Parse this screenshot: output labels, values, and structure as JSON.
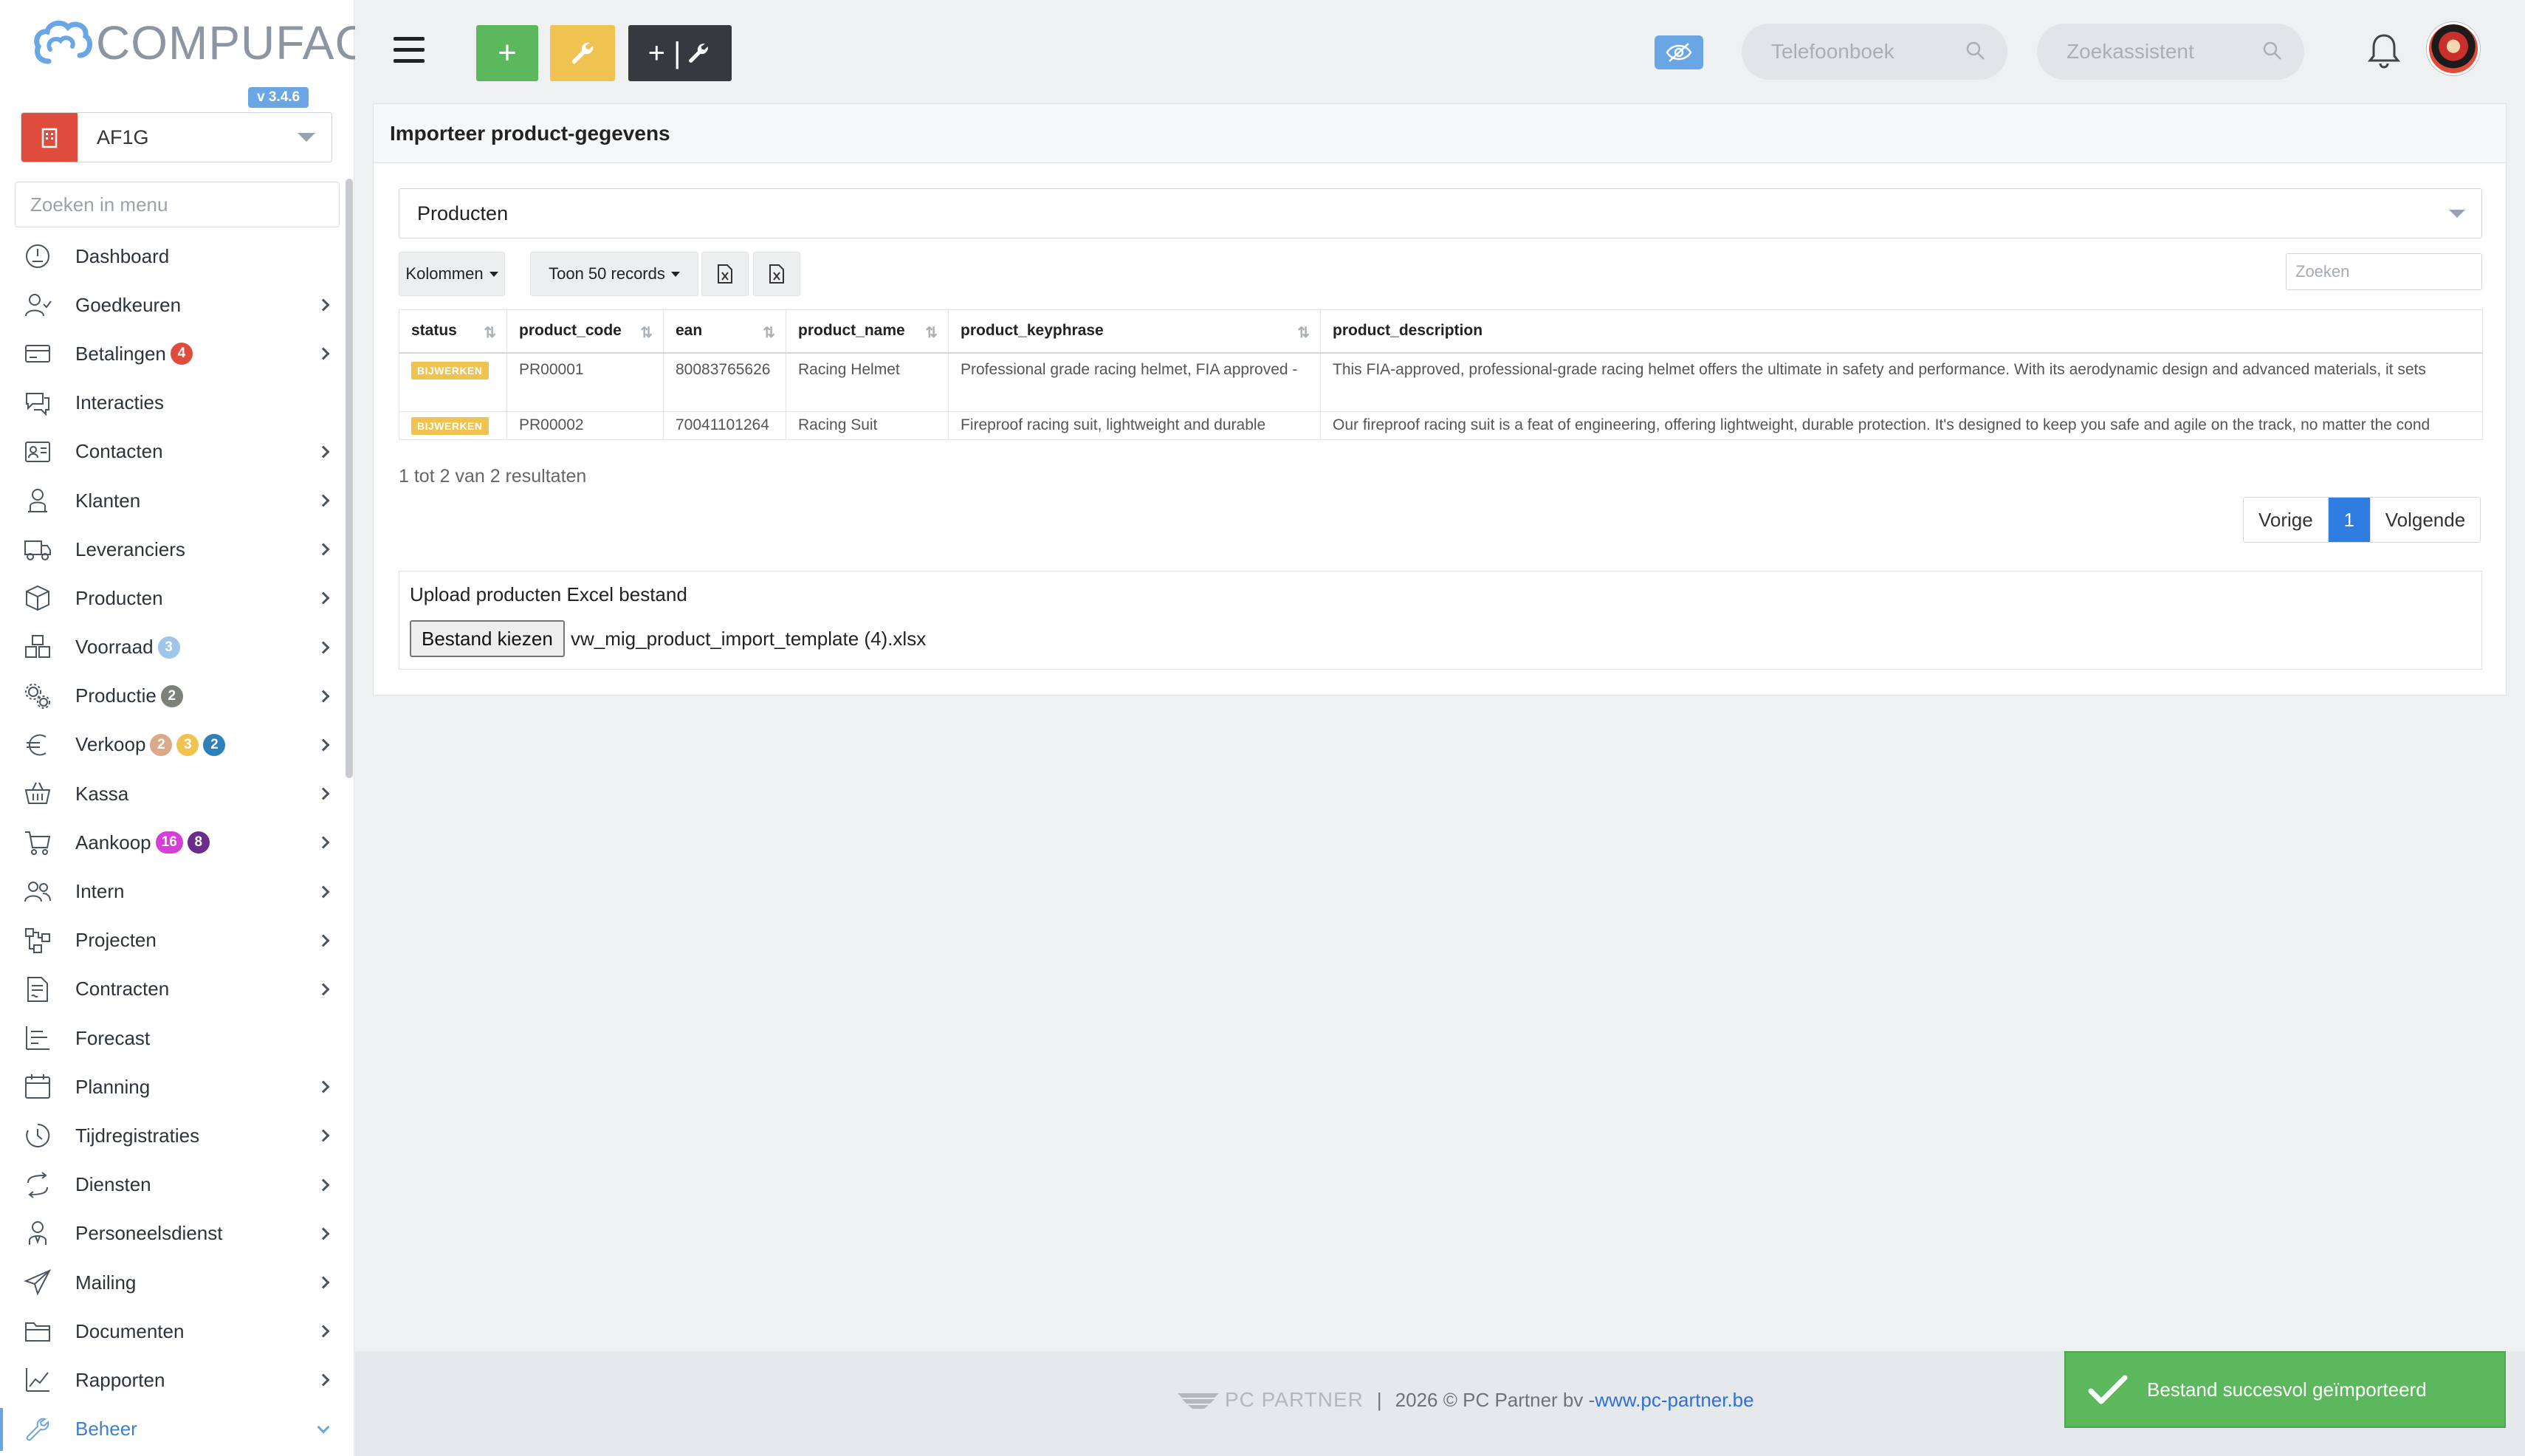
{
  "app": {
    "brand": "COMPUFACT",
    "version": "v 3.4.6",
    "company": "AF1G"
  },
  "sidebar": {
    "search_placeholder": "Zoeken in menu",
    "items": [
      {
        "label": "Dashboard",
        "icon": "dashboard-gauge-icon",
        "chevron": false,
        "badges": []
      },
      {
        "label": "Goedkeuren",
        "icon": "user-check-icon",
        "chevron": true,
        "badges": []
      },
      {
        "label": "Betalingen",
        "icon": "credit-card-icon",
        "chevron": true,
        "badges": [
          {
            "text": "4",
            "color": "#e04c3c"
          }
        ]
      },
      {
        "label": "Interacties",
        "icon": "chat-bubbles-icon",
        "chevron": false,
        "badges": []
      },
      {
        "label": "Contacten",
        "icon": "contact-card-icon",
        "chevron": true,
        "badges": []
      },
      {
        "label": "Klanten",
        "icon": "customer-icon",
        "chevron": true,
        "badges": []
      },
      {
        "label": "Leveranciers",
        "icon": "truck-icon",
        "chevron": true,
        "badges": []
      },
      {
        "label": "Producten",
        "icon": "box-icon",
        "chevron": true,
        "badges": []
      },
      {
        "label": "Voorraad",
        "icon": "boxes-icon",
        "chevron": true,
        "badges": [
          {
            "text": "3",
            "color": "#9ec5ea"
          }
        ]
      },
      {
        "label": "Productie",
        "icon": "gears-icon",
        "chevron": true,
        "badges": [
          {
            "text": "2",
            "color": "#7d8278"
          }
        ]
      },
      {
        "label": "Verkoop",
        "icon": "euro-icon",
        "chevron": true,
        "badges": [
          {
            "text": "2",
            "color": "#d9a98a"
          },
          {
            "text": "3",
            "color": "#f0c350"
          },
          {
            "text": "2",
            "color": "#2f7fb8"
          }
        ]
      },
      {
        "label": "Kassa",
        "icon": "basket-icon",
        "chevron": true,
        "badges": []
      },
      {
        "label": "Aankoop",
        "icon": "cart-icon",
        "chevron": true,
        "badges": [
          {
            "text": "16",
            "color": "#d63fd6"
          },
          {
            "text": "8",
            "color": "#6b2d8a"
          }
        ]
      },
      {
        "label": "Intern",
        "icon": "users-icon",
        "chevron": true,
        "badges": []
      },
      {
        "label": "Projecten",
        "icon": "project-nodes-icon",
        "chevron": true,
        "badges": []
      },
      {
        "label": "Contracten",
        "icon": "contract-icon",
        "chevron": true,
        "badges": []
      },
      {
        "label": "Forecast",
        "icon": "bar-chart-icon",
        "chevron": false,
        "badges": []
      },
      {
        "label": "Planning",
        "icon": "calendar-icon",
        "chevron": true,
        "badges": []
      },
      {
        "label": "Tijdregistraties",
        "icon": "clock-icon",
        "chevron": true,
        "badges": []
      },
      {
        "label": "Diensten",
        "icon": "repeat-icon",
        "chevron": true,
        "badges": []
      },
      {
        "label": "Personeelsdienst",
        "icon": "staff-icon",
        "chevron": true,
        "badges": []
      },
      {
        "label": "Mailing",
        "icon": "paper-plane-icon",
        "chevron": true,
        "badges": []
      },
      {
        "label": "Documenten",
        "icon": "folder-icon",
        "chevron": true,
        "badges": []
      },
      {
        "label": "Rapporten",
        "icon": "line-chart-icon",
        "chevron": true,
        "badges": []
      },
      {
        "label": "Beheer",
        "icon": "wrench-icon",
        "chevron": true,
        "badges": [],
        "active": true
      }
    ]
  },
  "topbar": {
    "plus_glyph": "+",
    "combo_glyph": "+ |",
    "phonebook_placeholder": "Telefoonboek",
    "assistant_placeholder": "Zoekassistent"
  },
  "panel": {
    "title": "Importeer product-gegevens",
    "selected_type": "Producten",
    "columns_btn": "Kolommen",
    "show_btn": "Toon 50 records",
    "search_placeholder": "Zoeken",
    "table": {
      "headers": [
        "status",
        "product_code",
        "ean",
        "product_name",
        "product_keyphrase",
        "product_description"
      ],
      "rows": [
        {
          "status": "BIJWERKEN",
          "product_code": "PR00001",
          "ean": "80083765626",
          "product_name": "Racing Helmet",
          "product_keyphrase": "Professional grade racing helmet, FIA approved -",
          "product_description": "This FIA-approved, professional-grade racing helmet offers the ultimate in safety and performance. With its aerodynamic design and advanced materials, it sets"
        },
        {
          "status": "BIJWERKEN",
          "product_code": "PR00002",
          "ean": "70041101264",
          "product_name": "Racing Suit",
          "product_keyphrase": "Fireproof racing suit, lightweight and durable",
          "product_description": "Our fireproof racing suit is a feat of engineering, offering lightweight, durable protection. It's designed to keep you safe and agile on the track, no matter the cond"
        }
      ]
    },
    "result_text": "1 tot 2 van 2 resultaten",
    "pager": {
      "prev": "Vorige",
      "current": "1",
      "next": "Volgende"
    },
    "upload": {
      "label": "Upload producten Excel bestand",
      "button": "Bestand kiezen",
      "filename": "vw_mig_product_import_template (4).xlsx"
    }
  },
  "footer": {
    "logo_text": "PC PARTNER",
    "sep": "|",
    "copyright": "2026 © PC Partner bv - ",
    "link": "www.pc-partner.be"
  },
  "toast": {
    "message": "Bestand succesvol geïmporteerd"
  }
}
